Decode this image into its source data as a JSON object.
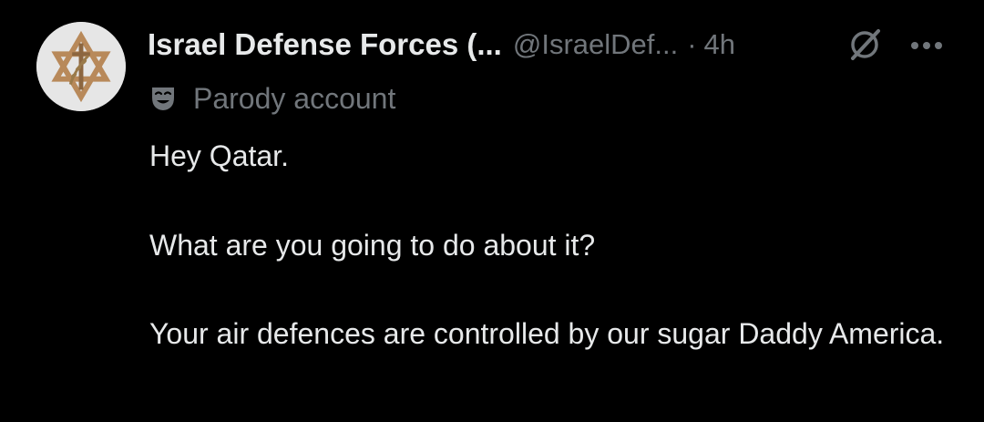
{
  "author": {
    "display_name": "Israel Defense Forces (...",
    "handle": "@IsraelDef...",
    "separator": "·",
    "time": "4h",
    "label": "Parody account"
  },
  "icons": {
    "avatar": "idf-emblem-icon",
    "grok": "grok-icon",
    "more": "more-options-icon",
    "parody": "theater-mask-icon"
  },
  "colors": {
    "background": "#000000",
    "primary_text": "#e7e9ea",
    "secondary_text": "#71767b",
    "avatar_bg": "#e6e6e6",
    "emblem_gold": "#b8895a"
  },
  "post": {
    "line1": "Hey Qatar.",
    "line2": "What are you going to do about it?",
    "line3": "Your air defences are controlled by our sugar Daddy America."
  }
}
